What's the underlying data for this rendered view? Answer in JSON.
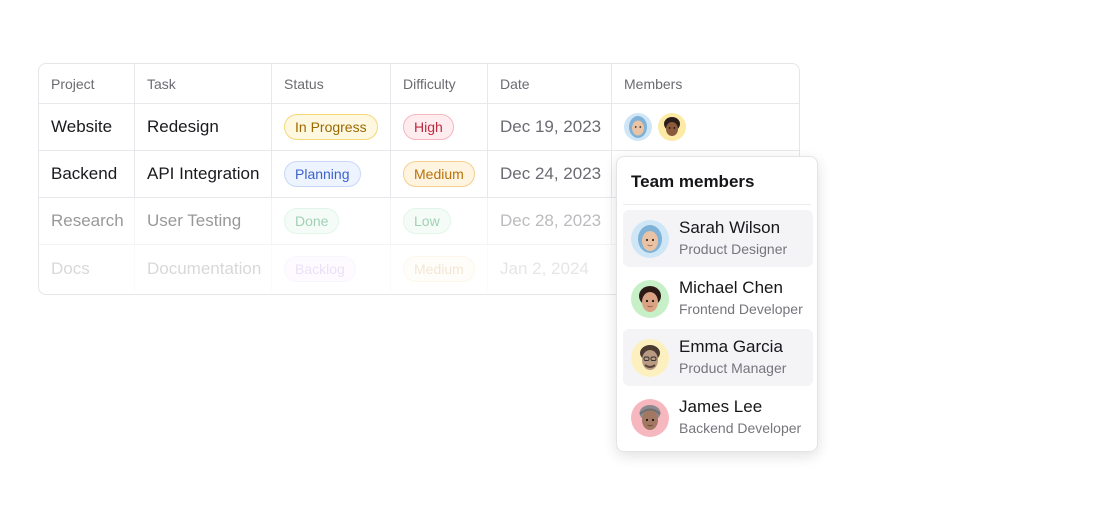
{
  "table": {
    "headers": {
      "project": "Project",
      "task": "Task",
      "status": "Status",
      "difficulty": "Difficulty",
      "date": "Date",
      "members": "Members"
    },
    "rows": [
      {
        "project": "Website",
        "task": "Redesign",
        "status": "In Progress",
        "difficulty": "High",
        "date": "Dec 19, 2023"
      },
      {
        "project": "Backend",
        "task": "API Integration",
        "status": "Planning",
        "difficulty": "Medium",
        "date": "Dec 24, 2023"
      },
      {
        "project": "Research",
        "task": "User Testing",
        "status": "Done",
        "difficulty": "Low",
        "date": "Dec 28, 2023"
      },
      {
        "project": "Docs",
        "task": "Documentation",
        "status": "Backlog",
        "difficulty": "Medium",
        "date": "Jan 2, 2024"
      }
    ]
  },
  "popover": {
    "title": "Team members",
    "members": [
      {
        "name": "Sarah Wilson",
        "role": "Product Designer",
        "avatar_bg": "#cfe6f7",
        "icon": "avatar-sarah-icon"
      },
      {
        "name": "Michael Chen",
        "role": "Frontend Developer",
        "avatar_bg": "#c8f0c8",
        "icon": "avatar-michael-icon"
      },
      {
        "name": "Emma Garcia",
        "role": "Product Manager",
        "avatar_bg": "#fdf0bf",
        "icon": "avatar-emma-icon"
      },
      {
        "name": "James Lee",
        "role": "Backend Developer",
        "avatar_bg": "#f7b7bf",
        "icon": "avatar-james-icon"
      }
    ]
  },
  "colors": {
    "in_progress": "#9a6a00",
    "planning": "#3c63c9",
    "done": "#2e9b5a",
    "backlog": "#8a4fd6",
    "high": "#c0283f",
    "medium": "#b7730a",
    "low": "#2e9b5a"
  }
}
